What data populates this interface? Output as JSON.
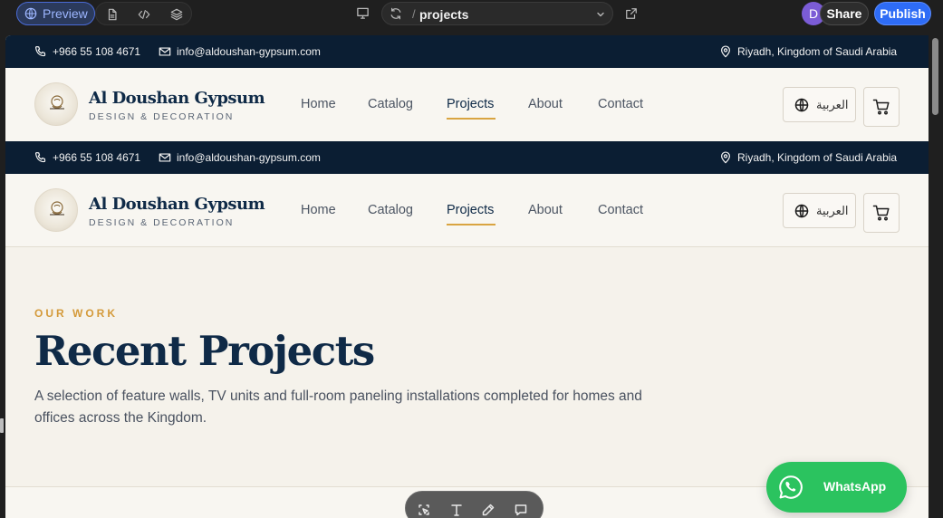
{
  "editor": {
    "preview_label": "Preview",
    "url_slash": "/",
    "url_path": "projects",
    "avatar_initial": "D",
    "share_label": "Share",
    "publish_label": "Publish",
    "accent": "#2e6cf6"
  },
  "site": {
    "topbar": {
      "phone": "+966 55 108 4671",
      "email": "info@aldoushan-gypsum.com",
      "location": "Riyadh, Kingdom of Saudi Arabia",
      "bg": "#0b1e33"
    },
    "brand": {
      "name": "Al Doushan Gypsum",
      "tagline": "DESIGN & DECORATION"
    },
    "nav": {
      "items": [
        "Home",
        "Catalog",
        "Projects",
        "About",
        "Contact"
      ],
      "active": "Projects",
      "language_label": "العربية"
    },
    "hero": {
      "eyebrow": "OUR WORK",
      "title": "Recent Projects",
      "subtitle": "A selection of feature walls, TV units and full-room paneling installations completed for homes and offices across the Kingdom."
    },
    "whatsapp_label": "WhatsApp",
    "whatsapp_color": "#2bc35f",
    "accent_gold": "#d9a441"
  },
  "icons": [
    "globe-icon",
    "file-icon",
    "code-icon",
    "layers-icon",
    "monitor-icon",
    "refresh-icon",
    "chevron-down-icon",
    "external-link-icon",
    "phone-icon",
    "mail-icon",
    "map-pin-icon",
    "cart-icon",
    "whatsapp-icon",
    "select-icon",
    "text-icon",
    "pencil-icon",
    "comment-icon"
  ]
}
